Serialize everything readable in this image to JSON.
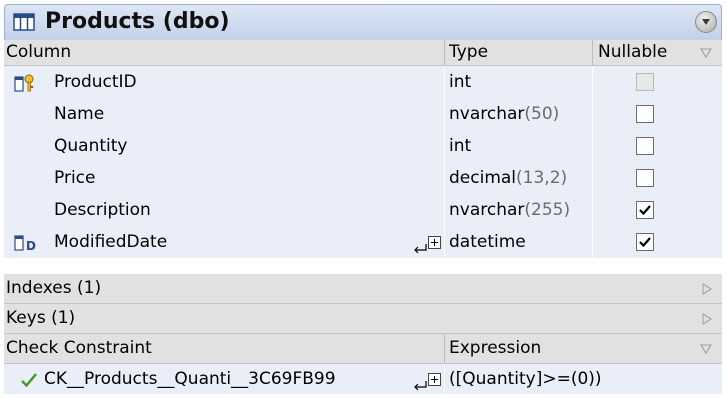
{
  "table": {
    "title": "Products (dbo)",
    "icons": {
      "table": "table-icon",
      "collapse": "collapse-circle-icon"
    }
  },
  "columns_header": {
    "column": "Column",
    "type": "Type",
    "nullable": "Nullable"
  },
  "columns": [
    {
      "name": "ProductID",
      "type_base": "int",
      "type_args": "",
      "nullable": false,
      "nullable_enabled": false,
      "icon": "primary-key-icon"
    },
    {
      "name": "Name",
      "type_base": "nvarchar",
      "type_args": "(50)",
      "nullable": false,
      "nullable_enabled": true,
      "icon": ""
    },
    {
      "name": "Quantity",
      "type_base": "int",
      "type_args": "",
      "nullable": false,
      "nullable_enabled": true,
      "icon": ""
    },
    {
      "name": "Price",
      "type_base": "decimal",
      "type_args": "(13,2)",
      "nullable": false,
      "nullable_enabled": true,
      "icon": ""
    },
    {
      "name": "Description",
      "type_base": "nvarchar",
      "type_args": "(255)",
      "nullable": true,
      "nullable_enabled": true,
      "icon": ""
    },
    {
      "name": "ModifiedDate",
      "type_base": "datetime",
      "type_args": "",
      "nullable": true,
      "nullable_enabled": true,
      "icon": "default-value-icon",
      "has_expand": true
    }
  ],
  "sections": {
    "indexes": "Indexes (1)",
    "keys": "Keys (1)"
  },
  "check_header": {
    "name": "Check Constraint",
    "expression": "Expression"
  },
  "check_constraints": [
    {
      "name": "CK__Products__Quanti__3C69FB99",
      "expression": "([Quantity]>=(0))",
      "icon": "checkmark-icon"
    }
  ],
  "colors": {
    "row_bg": "#e9eef8",
    "header_bg": "#e1e1e1",
    "title_bg": "#c3d1ea",
    "arg_color": "#6b6b6b"
  }
}
